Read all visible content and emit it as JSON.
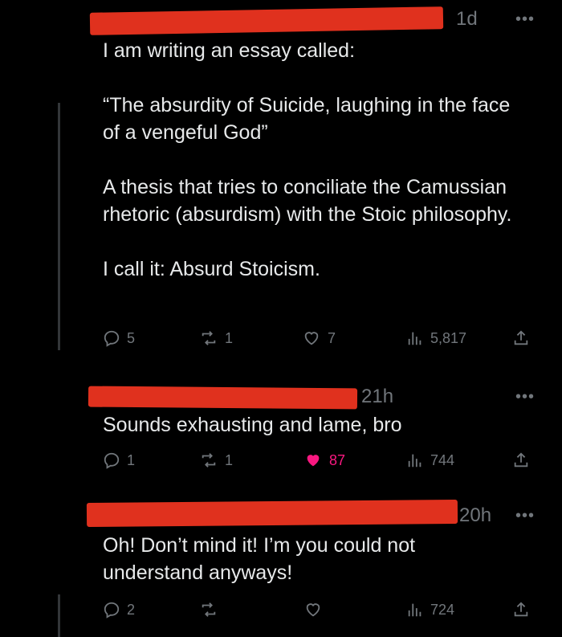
{
  "tweets": [
    {
      "time": "1d",
      "text": "I am writing an essay called:\n\n“The absurdity of Suicide, laughing in the face of a vengeful God”\n\nA thesis that tries to conciliate the Camussian rhetoric (absurdism) with the Stoic philosophy.\n\nI call it: Absurd Stoicism.",
      "replies": "5",
      "reposts": "1",
      "likes": "7",
      "views": "5,817",
      "liked": false
    },
    {
      "time": "21h",
      "text": "Sounds exhausting and lame, bro",
      "replies": "1",
      "reposts": "1",
      "likes": "87",
      "views": "744",
      "liked": true
    },
    {
      "time": "20h",
      "text": "Oh! Don’t mind it! I’m you could not understand anyways!",
      "replies": "2",
      "reposts": "",
      "likes": "",
      "views": "724",
      "liked": false
    }
  ],
  "colors": {
    "background": "#000000",
    "text": "#e7e9ea",
    "muted": "#71767b",
    "like_active": "#f91880",
    "redaction": "#e0311e",
    "thread_line": "#333639"
  },
  "icons": [
    "reply-icon",
    "repost-icon",
    "like-icon",
    "views-icon",
    "share-icon",
    "more-icon"
  ]
}
